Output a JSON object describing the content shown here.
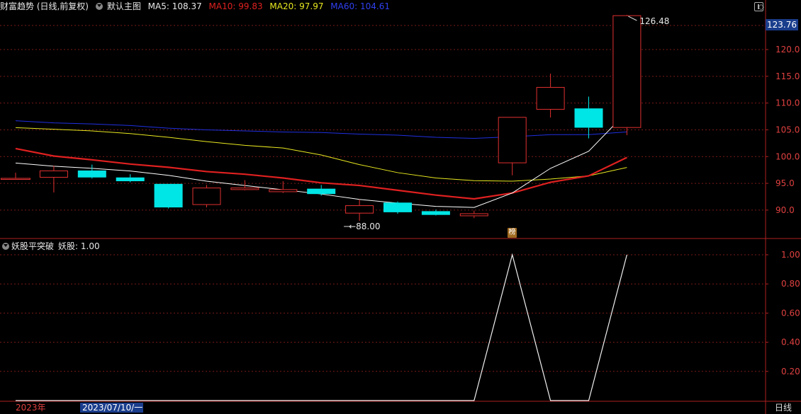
{
  "header": {
    "stock_name": "财富趋势 (日线,前复权)",
    "main_indicator": "默认主图",
    "ma5_label": "MA5: 108.37",
    "ma10_label": "MA10: 99.83",
    "ma20_label": "MA20: 97.97",
    "ma60_label": "MA60: 104.61"
  },
  "colors": {
    "ma5": "#ffffff",
    "ma10": "#e02020",
    "ma20": "#e8e820",
    "ma60": "#2030e0",
    "up": "#e03030",
    "down": "#00e5e5",
    "axis": "#e04040",
    "grid": "#7a1a1a"
  },
  "price_axis": {
    "current_price": "123.76",
    "ticks": [
      "120.0",
      "115.0",
      "110.0",
      "105.0",
      "100.0",
      "95.0",
      "90.0"
    ]
  },
  "annotations": {
    "high": "126.48",
    "low": "88.00",
    "rank_badge": "榜"
  },
  "sub_panel": {
    "title": "妖股平突破",
    "value_label": "妖股: 1.00",
    "ticks": [
      "1.00",
      "0.80",
      "0.60",
      "0.40",
      "0.20"
    ]
  },
  "footer": {
    "year": "2023年",
    "cursor_date": "2023/07/10/一",
    "period": "日线"
  },
  "chart_data": {
    "type": "candlestick",
    "candles": [
      {
        "open": 96.0,
        "close": 96.0,
        "high": 97.0,
        "low": 96.0,
        "dir": "flat"
      },
      {
        "open": 96.2,
        "close": 97.4,
        "high": 98.3,
        "low": 93.3,
        "dir": "up"
      },
      {
        "open": 97.4,
        "close": 96.1,
        "high": 98.5,
        "low": 95.9,
        "dir": "down"
      },
      {
        "open": 96.1,
        "close": 95.4,
        "high": 96.7,
        "low": 95.2,
        "dir": "down"
      },
      {
        "open": 94.9,
        "close": 90.5,
        "high": 94.9,
        "low": 90.3,
        "dir": "down"
      },
      {
        "open": 91.1,
        "close": 94.2,
        "high": 94.7,
        "low": 90.5,
        "dir": "up"
      },
      {
        "open": 93.9,
        "close": 94.2,
        "high": 95.6,
        "low": 93.7,
        "dir": "up"
      },
      {
        "open": 93.5,
        "close": 93.9,
        "high": 95.4,
        "low": 93.2,
        "dir": "up"
      },
      {
        "open": 94.0,
        "close": 93.0,
        "high": 94.7,
        "low": 92.7,
        "dir": "down"
      },
      {
        "open": 89.5,
        "close": 90.9,
        "high": 92.0,
        "low": 88.0,
        "dir": "up"
      },
      {
        "open": 91.4,
        "close": 89.6,
        "high": 91.6,
        "low": 89.3,
        "dir": "down"
      },
      {
        "open": 89.8,
        "close": 89.1,
        "high": 90.1,
        "low": 89.0,
        "dir": "down"
      },
      {
        "open": 89.0,
        "close": 89.4,
        "high": 89.9,
        "low": 88.5,
        "dir": "up"
      },
      {
        "open": 98.9,
        "close": 107.4,
        "high": 107.4,
        "low": 96.5,
        "dir": "up"
      },
      {
        "open": 108.9,
        "close": 113.0,
        "high": 115.5,
        "low": 107.3,
        "dir": "up"
      },
      {
        "open": 109.0,
        "close": 105.4,
        "high": 111.2,
        "low": 103.4,
        "dir": "down"
      },
      {
        "open": 105.5,
        "close": 126.4,
        "high": 126.48,
        "low": 104.0,
        "dir": "up"
      }
    ],
    "ma5": [
      98.8,
      98.2,
      97.8,
      97.3,
      96.5,
      95.4,
      94.6,
      93.8,
      93.0,
      92.0,
      91.3,
      90.7,
      90.5,
      93.2,
      97.8,
      101.0,
      108.37
    ],
    "ma10": [
      101.5,
      100.1,
      99.4,
      98.6,
      98.0,
      97.2,
      96.7,
      96.0,
      95.1,
      94.6,
      93.7,
      92.8,
      92.1,
      93.2,
      95.2,
      96.4,
      99.83
    ],
    "ma20": [
      105.4,
      105.1,
      104.8,
      104.3,
      103.6,
      102.8,
      102.1,
      101.6,
      100.3,
      98.5,
      97.0,
      96.0,
      95.5,
      95.4,
      95.8,
      96.4,
      97.97
    ],
    "ma60": [
      106.7,
      106.3,
      106.1,
      105.8,
      105.3,
      105.0,
      104.8,
      104.6,
      104.5,
      104.2,
      104.0,
      103.6,
      103.4,
      103.7,
      104.1,
      104.1,
      104.61
    ],
    "yao_gu": [
      0,
      0,
      0,
      0,
      0,
      0,
      0,
      0,
      0,
      0,
      0,
      0,
      0,
      1,
      0,
      0,
      1
    ],
    "ylim_main": [
      87.0,
      126.5
    ],
    "ylim_sub": [
      0,
      1.05
    ]
  }
}
